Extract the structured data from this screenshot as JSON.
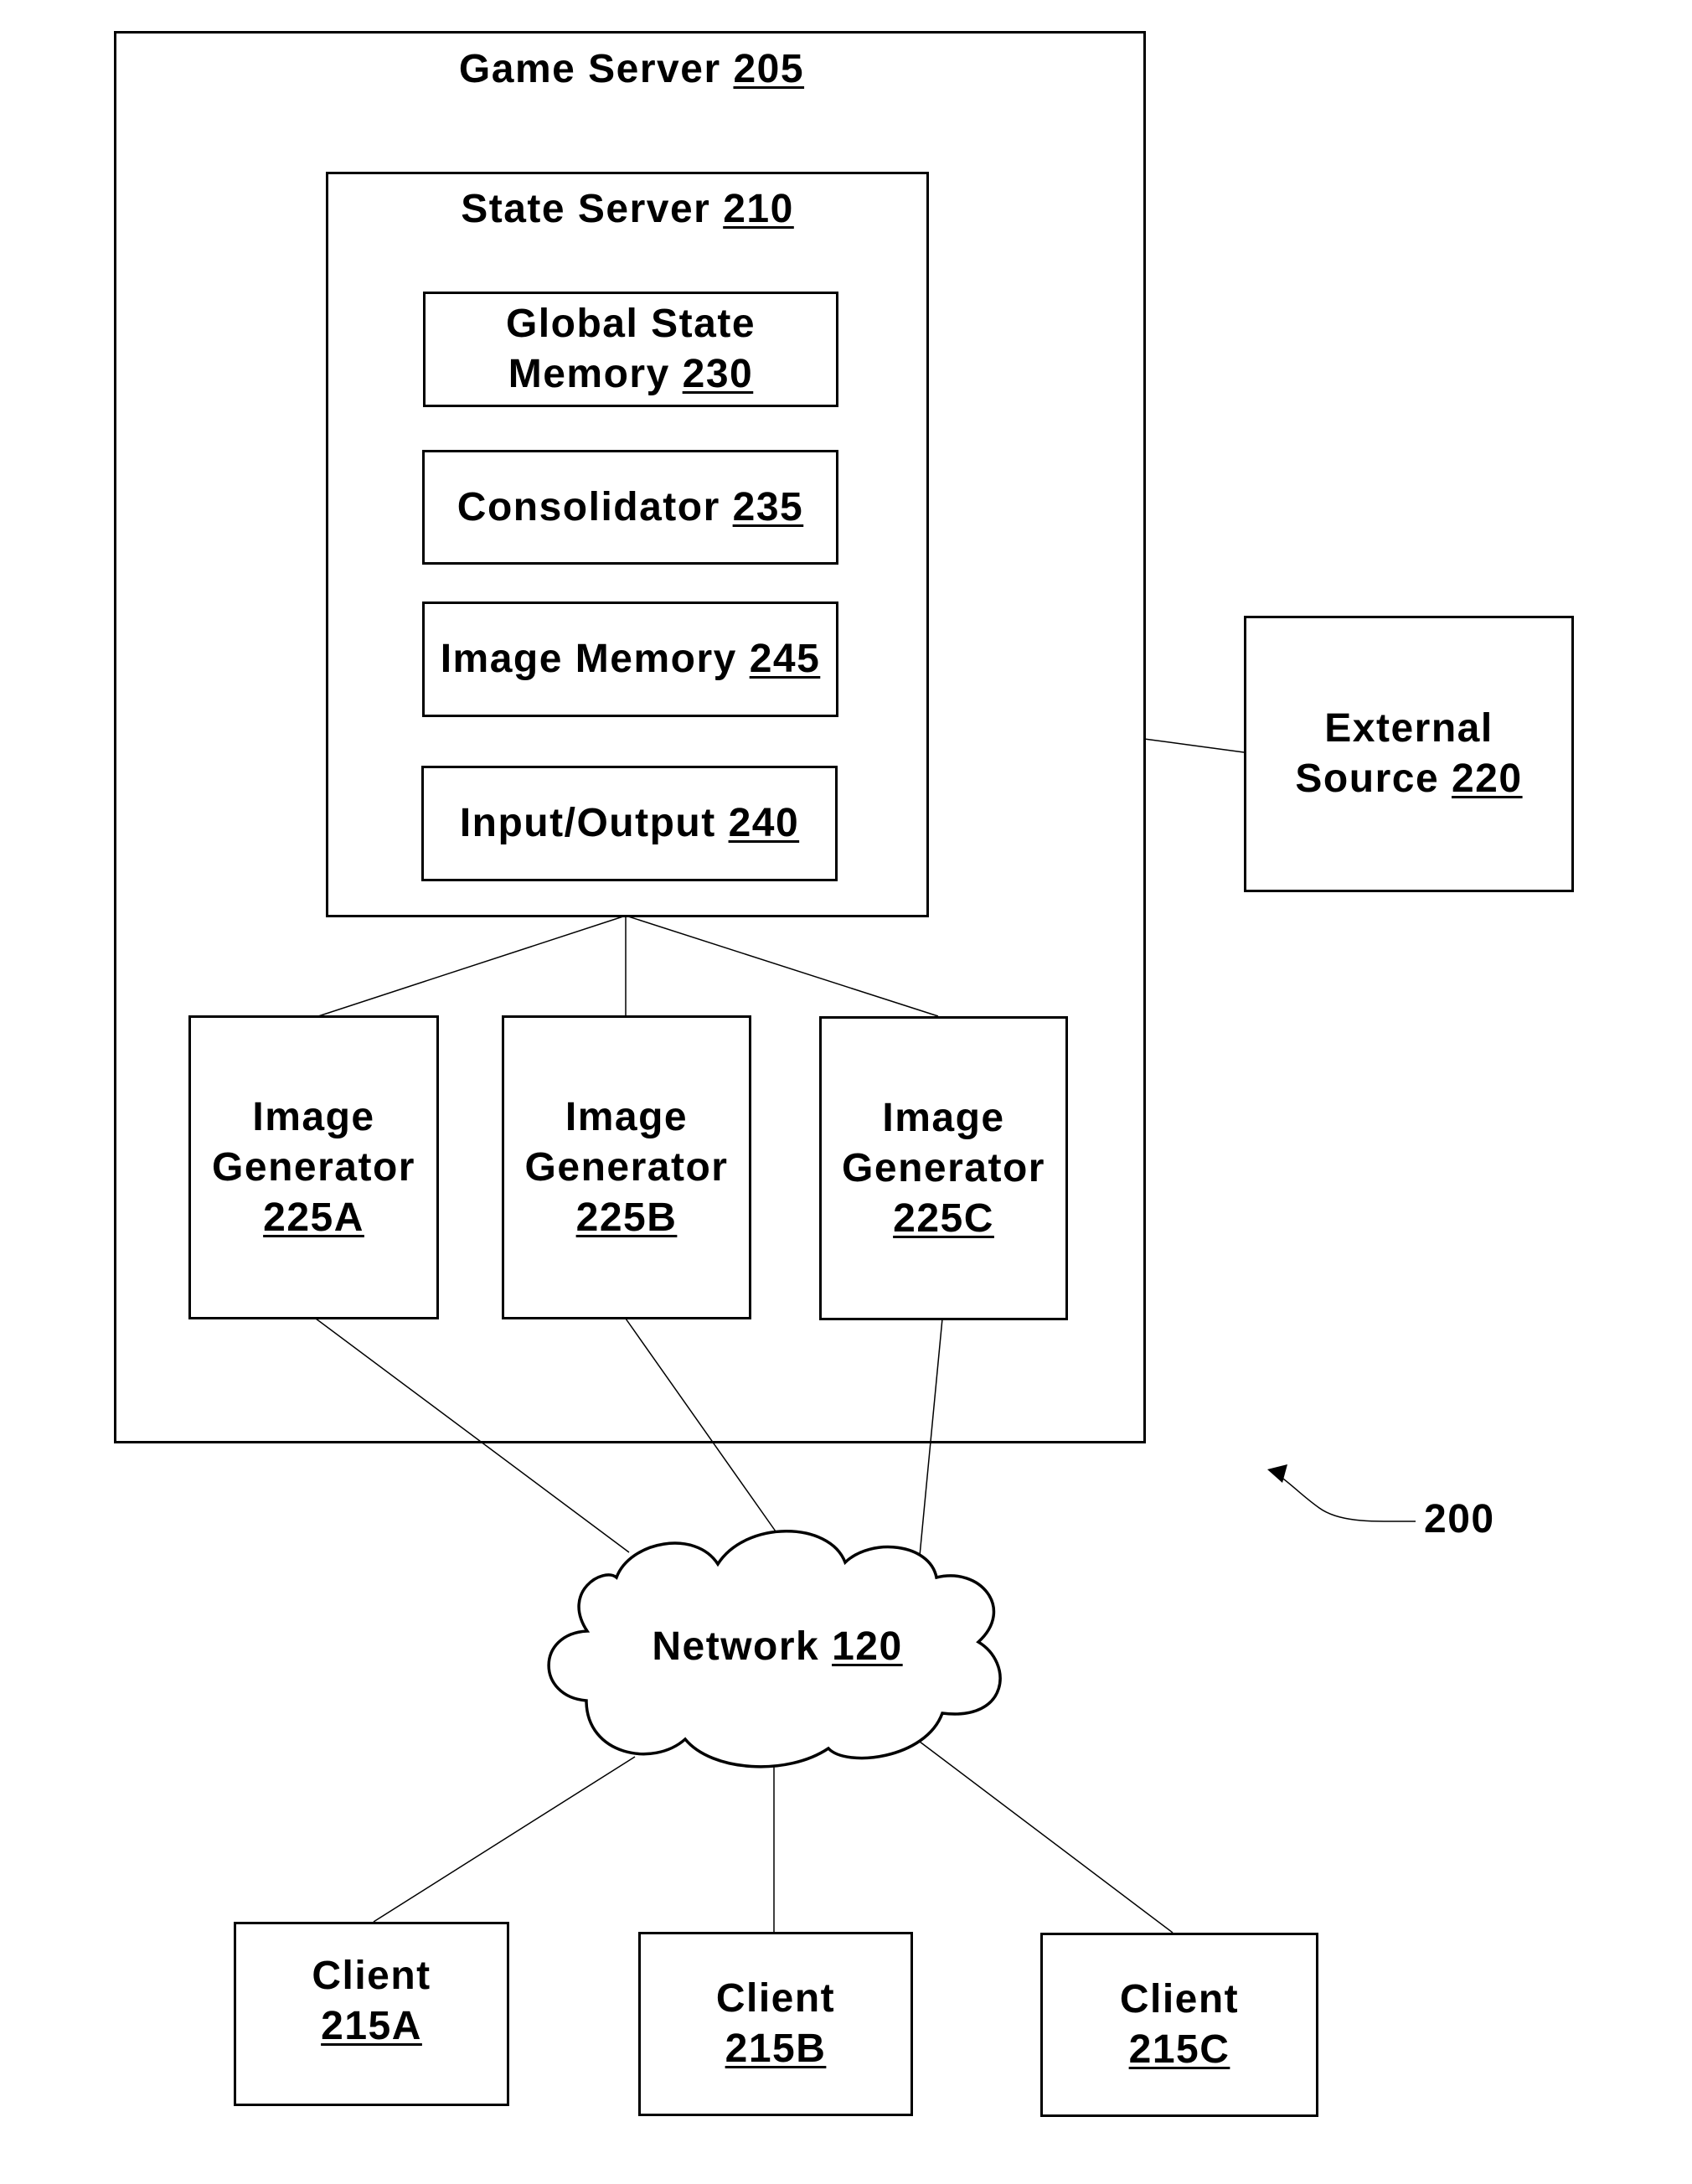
{
  "figure": {
    "reference_numeral": "200",
    "game_server": {
      "name": "Game Server",
      "ref": "205"
    },
    "state_server": {
      "name": "State Server",
      "ref": "210"
    },
    "state_components": [
      {
        "id": "global-state-memory",
        "lines": [
          "Global State",
          "Memory"
        ],
        "ref": "230"
      },
      {
        "id": "consolidator",
        "lines": [
          "Consolidator"
        ],
        "ref": "235"
      },
      {
        "id": "image-memory",
        "lines": [
          "Image Memory"
        ],
        "ref": "245"
      },
      {
        "id": "input-output",
        "lines": [
          "Input/Output"
        ],
        "ref": "240"
      }
    ],
    "image_generators": [
      {
        "name_lines": [
          "Image",
          "Generator"
        ],
        "ref": "225A"
      },
      {
        "name_lines": [
          "Image",
          "Generator"
        ],
        "ref": "225B"
      },
      {
        "name_lines": [
          "Image",
          "Generator"
        ],
        "ref": "225C"
      }
    ],
    "external_source": {
      "name_lines": [
        "External",
        "Source"
      ],
      "ref": "220"
    },
    "network": {
      "name": "Network",
      "ref": "120"
    },
    "clients": [
      {
        "name": "Client",
        "ref": "215A"
      },
      {
        "name": "Client",
        "ref": "215B"
      },
      {
        "name": "Client",
        "ref": "215C"
      }
    ],
    "connections": [
      [
        "state-server",
        "image-generator-225A"
      ],
      [
        "state-server",
        "image-generator-225B"
      ],
      [
        "state-server",
        "image-generator-225C"
      ],
      [
        "game-server",
        "external-source-220"
      ],
      [
        "image-generator-225A",
        "network-120"
      ],
      [
        "image-generator-225B",
        "network-120"
      ],
      [
        "image-generator-225C",
        "network-120"
      ],
      [
        "network-120",
        "client-215A"
      ],
      [
        "network-120",
        "client-215B"
      ],
      [
        "network-120",
        "client-215C"
      ]
    ]
  }
}
